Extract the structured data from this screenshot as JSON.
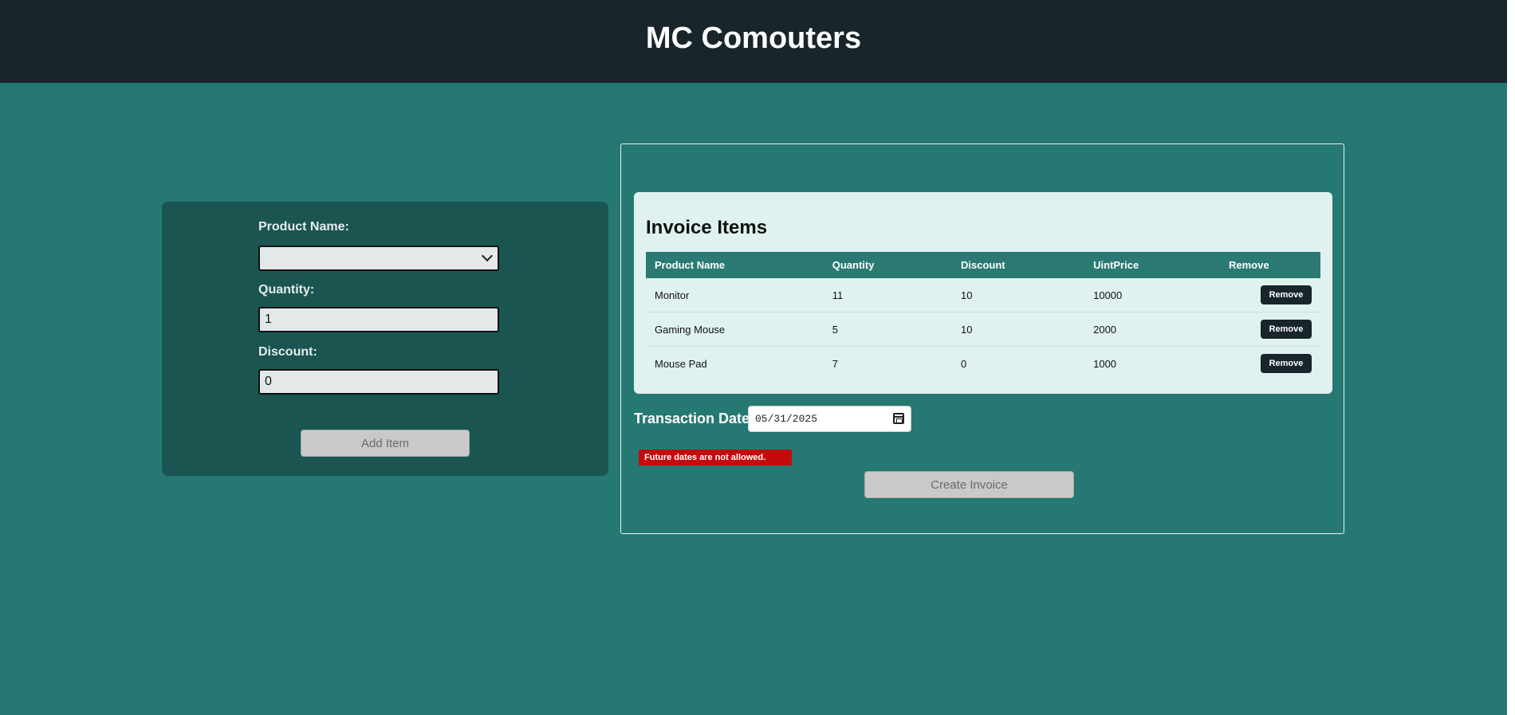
{
  "header": {
    "title": "MC Comouters"
  },
  "form": {
    "product_label": "Product Name:",
    "product_value": "",
    "quantity_label": "Quantity:",
    "quantity_value": "1",
    "discount_label": "Discount:",
    "discount_value": "0",
    "add_button": "Add Item"
  },
  "invoice": {
    "title": "Invoice Items",
    "columns": [
      "Product Name",
      "Quantity",
      "Discount",
      "UintPrice",
      "Remove"
    ],
    "rows": [
      {
        "name": "Monitor",
        "quantity": "11",
        "discount": "10",
        "price": "10000",
        "remove": "Remove"
      },
      {
        "name": "Gaming Mouse",
        "quantity": "5",
        "discount": "10",
        "price": "2000",
        "remove": "Remove"
      },
      {
        "name": "Mouse Pad",
        "quantity": "7",
        "discount": "0",
        "price": "1000",
        "remove": "Remove"
      }
    ],
    "transaction_label": "Transaction Date",
    "transaction_date": "05/31/2025",
    "error": "Future dates are not allowed.",
    "create_button": "Create Invoice"
  },
  "icons": {
    "select_chevron": "chevron-down-icon",
    "calendar": "calendar-icon"
  },
  "colors": {
    "background": "#267872",
    "header": "#18252b",
    "form_panel": "#1a5551",
    "card": "#dff2f0",
    "table_header": "#2a7a73",
    "error": "#c40b0b"
  }
}
